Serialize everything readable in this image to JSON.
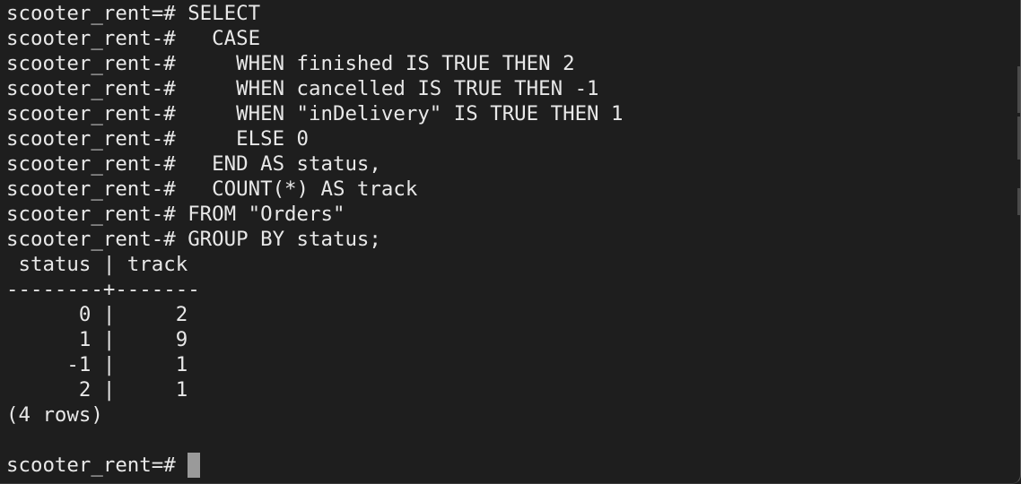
{
  "terminal": {
    "lines": [
      "scooter_rent=# SELECT",
      "scooter_rent-#   CASE",
      "scooter_rent-#     WHEN finished IS TRUE THEN 2",
      "scooter_rent-#     WHEN cancelled IS TRUE THEN -1",
      "scooter_rent-#     WHEN \"inDelivery\" IS TRUE THEN 1",
      "scooter_rent-#     ELSE 0",
      "scooter_rent-#   END AS status,",
      "scooter_rent-#   COUNT(*) AS track",
      "scooter_rent-# FROM \"Orders\"",
      "scooter_rent-# GROUP BY status;",
      " status | track",
      "--------+-------",
      "      0 |     2",
      "      1 |     9",
      "     -1 |     1",
      "      2 |     1",
      "(4 rows)",
      "",
      "scooter_rent=# "
    ],
    "colors": {
      "background": "#1e1e1e",
      "text": "#e8e8e8",
      "cursor": "#9a9a9a"
    }
  }
}
